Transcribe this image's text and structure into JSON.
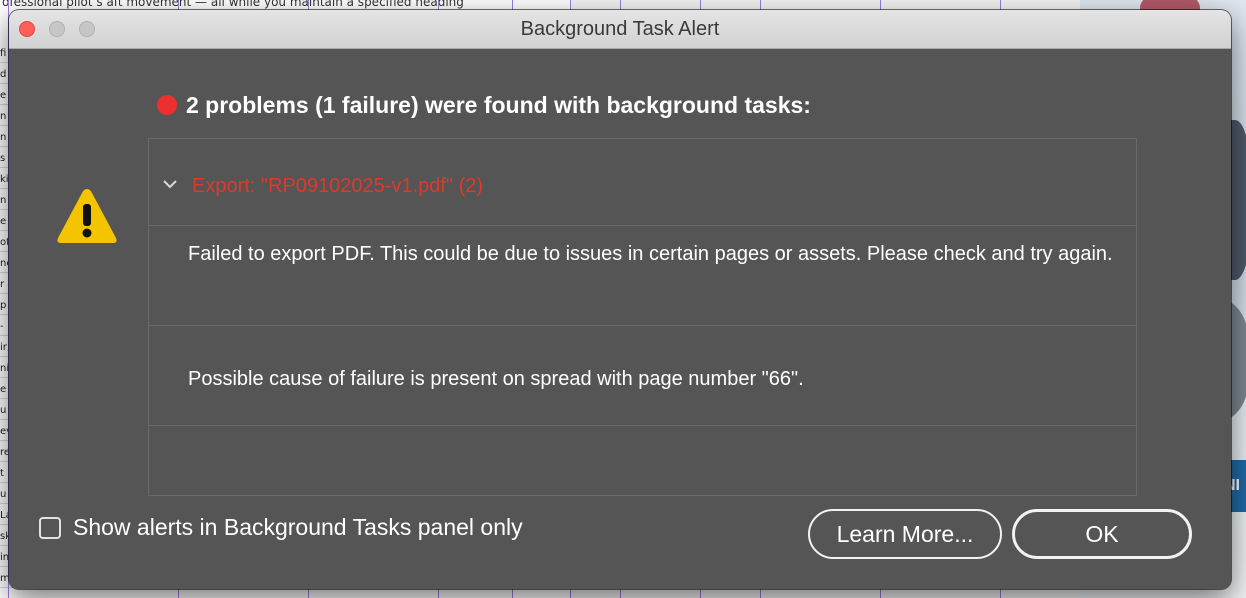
{
  "window": {
    "title": "Background Task Alert"
  },
  "background": {
    "top_text": "ofessional pilot s   aft movement — all while you maintain a specified heading",
    "gutter_letters": [
      "fi",
      "d",
      "e",
      "n",
      "n",
      "s",
      "ki",
      "n",
      "e",
      "of",
      "ne",
      "r a",
      "p",
      "-",
      "ir,",
      "ni",
      "e",
      "u",
      "ev",
      "re",
      "t",
      "u",
      "La",
      "sk",
      "in",
      "m"
    ],
    "side_banner_text": "NI"
  },
  "alert": {
    "headline": "2 problems (1 failure) were found with background tasks:",
    "status_color": "#ee2f2f",
    "task": {
      "label": "Export: \"RP09102025-v1.pdf\" (2)",
      "label_color": "#e0392b",
      "expanded": true
    },
    "messages": [
      "Failed to export PDF. This could be due to issues in certain pages or assets. Please check and try again.",
      "Possible cause of failure is present on spread with page number \"66\"."
    ]
  },
  "footer": {
    "checkbox_label": "Show alerts in Background Tasks panel only",
    "checkbox_checked": false,
    "learn_more_label": "Learn More...",
    "ok_label": "OK"
  },
  "icons": {
    "status": "red-dot-icon",
    "warning": "warning-triangle-icon",
    "chevron": "chevron-down-icon"
  }
}
